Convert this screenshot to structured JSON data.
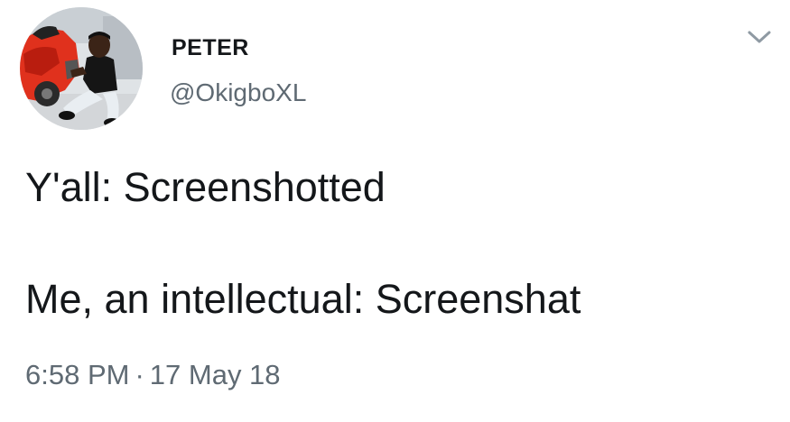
{
  "author": {
    "display_name": "PETER",
    "handle": "@OkigboXL"
  },
  "tweet": {
    "lines": [
      "Y'all: Screenshotted",
      "Me, an intellectual: Screenshat"
    ],
    "time": "6:58 PM",
    "separator": "·",
    "date": "17 May 18"
  },
  "icons": {
    "menu": "chevron-down-icon"
  },
  "colors": {
    "text_primary": "#14171a",
    "text_secondary": "#5f6a73",
    "background": "#ffffff"
  }
}
